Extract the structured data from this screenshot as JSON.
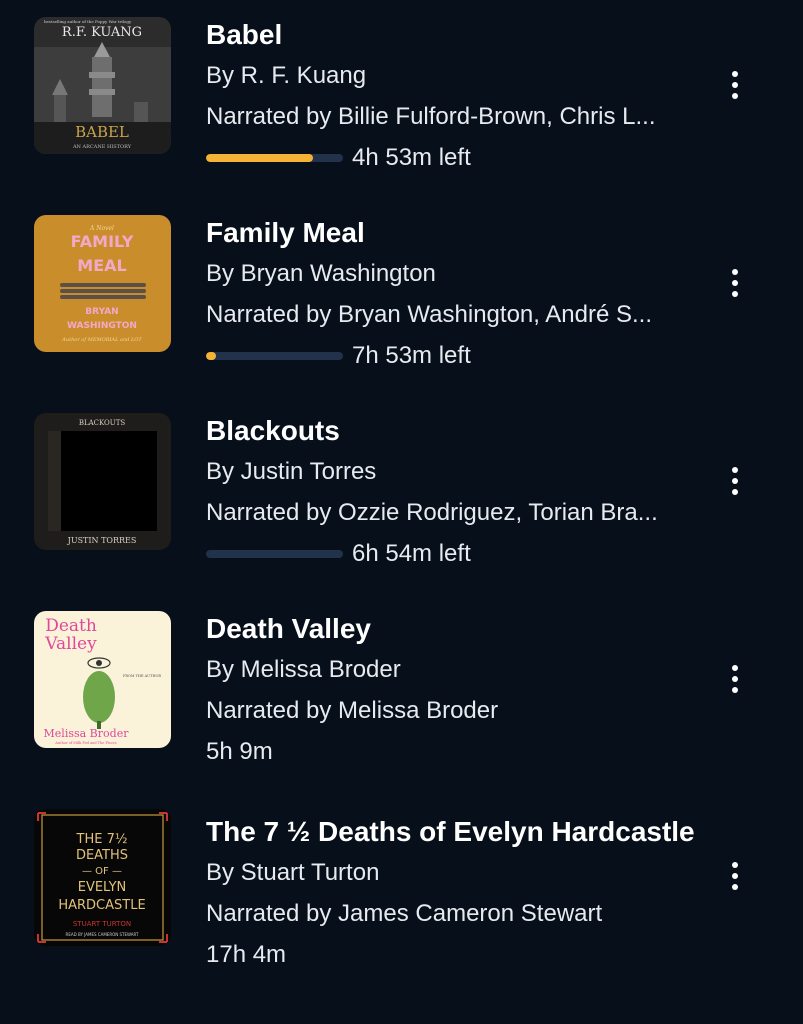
{
  "books": [
    {
      "title": "Babel",
      "author": "By R. F. Kuang",
      "narrator": "Narrated by Billie Fulford-Brown, Chris L...",
      "time": "4h 53m left",
      "progress": 0.78,
      "cover": {
        "author_text": "R.F. KUANG",
        "title_text": "BABEL",
        "top_text": "bestselling author of the Poppy War trilogy",
        "subtitle_text": "AN ARCANE HISTORY"
      }
    },
    {
      "title": "Family Meal",
      "author": "By Bryan Washington",
      "narrator": "Narrated by Bryan Washington, André S...",
      "time": "7h 53m left",
      "progress": 0.07,
      "cover": {
        "top_text": "A Novel",
        "title_line1": "FAMILY",
        "title_line2": "MEAL",
        "author_line1": "BRYAN",
        "author_line2": "WASHINGTON",
        "tagline": "Author of MEMORIAL and LOT"
      }
    },
    {
      "title": "Blackouts",
      "author": "By Justin Torres",
      "narrator": "Narrated by Ozzie Rodriguez, Torian Bra...",
      "time": "6h 54m left",
      "progress": 0,
      "cover": {
        "title_text": "BLACKOUTS",
        "author_text": "JUSTIN TORRES"
      }
    },
    {
      "title": "Death Valley",
      "author": "By Melissa Broder",
      "narrator": "Narrated by Melissa Broder",
      "time": "5h 9m",
      "cover": {
        "title_line1": "Death",
        "title_line2": "Valley",
        "author_text": "Melissa Broder",
        "side_text": "FROM THE AUTHOR",
        "tagline": "Author of Milk Fed and The Pisces"
      }
    },
    {
      "title": "The 7 ½ Deaths of Evelyn Hardcastle",
      "author": "By Stuart Turton",
      "narrator": "Narrated by James Cameron Stewart",
      "time": "17h 4m",
      "cover": {
        "title_line1": "THE 7½",
        "title_line2": "DEATHS",
        "title_line3": "— OF —",
        "title_line4": "EVELYN",
        "title_line5": "HARDCASTLE",
        "author_text": "STUART TURTON",
        "narrator_text": "READ BY JAMES CAMERON STEWART"
      }
    }
  ],
  "colors": {
    "background": "#070f1b",
    "progress_fill": "#f5b335",
    "progress_track": "#22324a"
  },
  "icons": {
    "more": "more-vertical-icon"
  }
}
